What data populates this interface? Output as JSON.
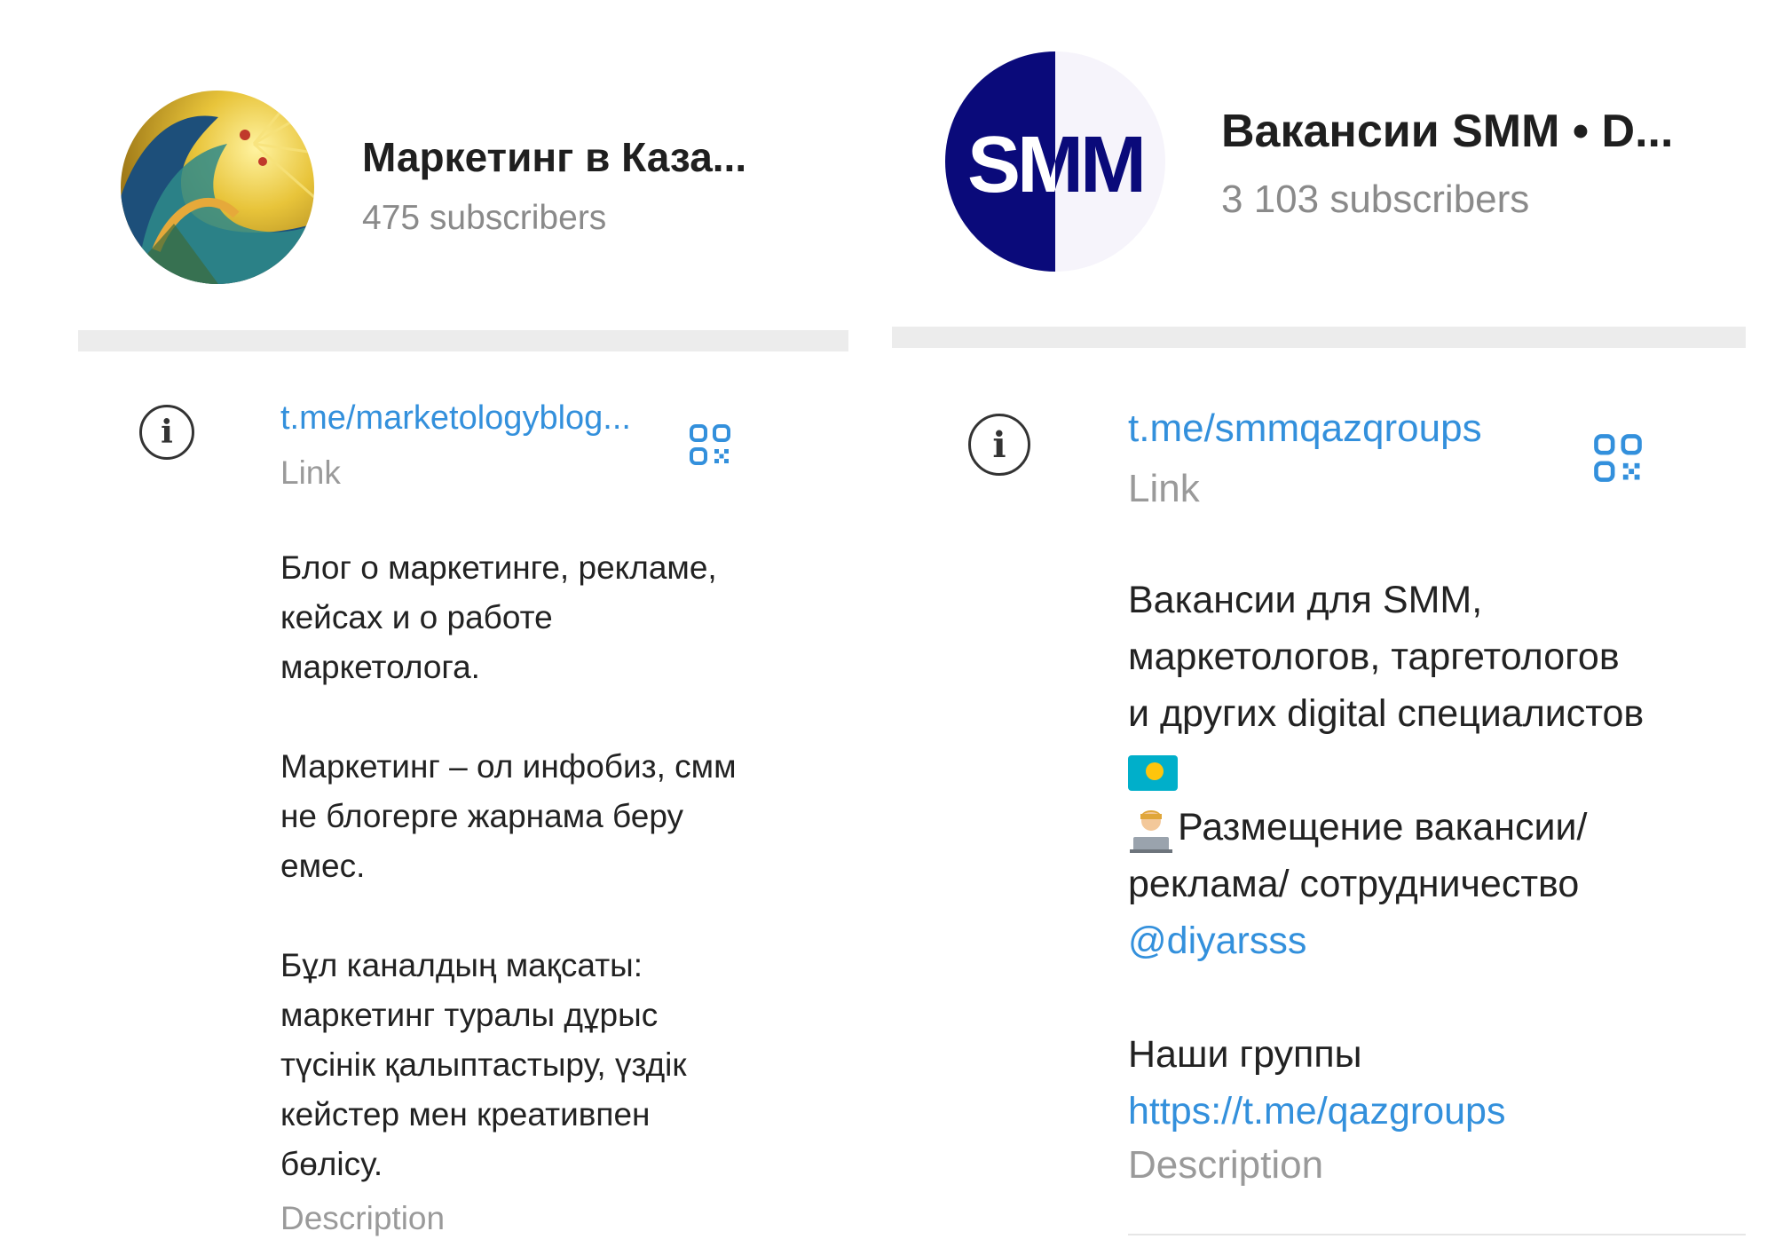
{
  "left_channel": {
    "title": "Маркетинг в Каза...",
    "subscribers": "475 subscribers",
    "link": "t.me/marketologyblog...",
    "link_label": "Link",
    "description_lines": [
      [
        "Блог о маркетинге, рекламе,",
        "кейсах и о работе",
        "маркетолога."
      ],
      [
        "Маркетинг –  ол инфобиз, смм",
        "не блогерге жарнама беру",
        "емес."
      ],
      [
        "Бұл каналдың мақсаты:",
        "маркетинг туралы дұрыс",
        "түсінік қалыптастыру, үздік",
        "кейстер мен креативпен",
        "бөлісу."
      ]
    ],
    "description_label": "Description",
    "avatar_icon": "sun-wave-painting-avatar",
    "info_icon": "info-icon",
    "qr_icon": "qr-code-icon"
  },
  "right_channel": {
    "title": "Вакансии SMM • D...",
    "subscribers": "3 103 subscribers",
    "avatar_text": "SMM",
    "link": "t.me/smmqazqroups",
    "link_label": "Link",
    "desc_line1": "Вакансии для SMM,",
    "desc_line2": "маркетологов, таргетологов",
    "desc_line3": "и других digital специалистов",
    "flag_icon": "kazakhstan-flag-emoji",
    "person_icon": "person-laptop-emoji",
    "desc_line5": "Размещение вакансии/",
    "desc_line6": "реклама/ сотрудничество",
    "mention": "@diyarsss",
    "groups_label": "Наши группы",
    "groups_url": "https://t.me/qazgroups",
    "description_label": "Description"
  },
  "colors": {
    "link": "#3390dc",
    "muted": "#8a8a8a",
    "divider": "#ececec",
    "smm_navy": "#0a0a7a"
  }
}
